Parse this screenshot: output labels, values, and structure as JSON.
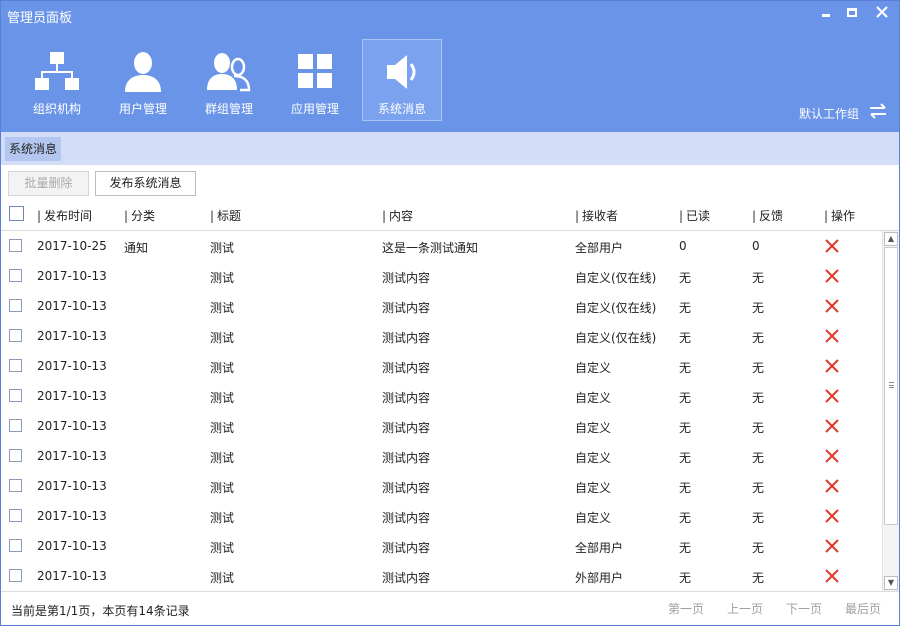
{
  "app": {
    "title": "管理员面板"
  },
  "nav": {
    "items": [
      {
        "label": "组织机构",
        "icon": "org-chart-icon"
      },
      {
        "label": "用户管理",
        "icon": "user-icon"
      },
      {
        "label": "群组管理",
        "icon": "group-icon"
      },
      {
        "label": "应用管理",
        "icon": "apps-grid-icon"
      },
      {
        "label": "系统消息",
        "icon": "speaker-icon",
        "active": true
      }
    ]
  },
  "workgroup": {
    "label": "默认工作组"
  },
  "tabs": [
    {
      "label": "系统消息"
    }
  ],
  "toolbar": {
    "batch_delete": "批量删除",
    "publish": "发布系统消息"
  },
  "table": {
    "columns": [
      "发布时间",
      "分类",
      "标题",
      "内容",
      "接收者",
      "已读",
      "反馈",
      "操作"
    ],
    "rows": [
      {
        "time": "2017-10-25",
        "category": "通知",
        "title": "测试",
        "content": "这是一条测试通知",
        "receiver": "全部用户",
        "read": "0",
        "feedback": "0"
      },
      {
        "time": "2017-10-13",
        "category": "",
        "title": "测试",
        "content": "测试内容",
        "receiver": "自定义(仅在线)",
        "read": "无",
        "feedback": "无"
      },
      {
        "time": "2017-10-13",
        "category": "",
        "title": "测试",
        "content": "测试内容",
        "receiver": "自定义(仅在线)",
        "read": "无",
        "feedback": "无"
      },
      {
        "time": "2017-10-13",
        "category": "",
        "title": "测试",
        "content": "测试内容",
        "receiver": "自定义(仅在线)",
        "read": "无",
        "feedback": "无"
      },
      {
        "time": "2017-10-13",
        "category": "",
        "title": "测试",
        "content": "测试内容",
        "receiver": "自定义",
        "read": "无",
        "feedback": "无"
      },
      {
        "time": "2017-10-13",
        "category": "",
        "title": "测试",
        "content": "测试内容",
        "receiver": "自定义",
        "read": "无",
        "feedback": "无"
      },
      {
        "time": "2017-10-13",
        "category": "",
        "title": "测试",
        "content": "测试内容",
        "receiver": "自定义",
        "read": "无",
        "feedback": "无"
      },
      {
        "time": "2017-10-13",
        "category": "",
        "title": "测试",
        "content": "测试内容",
        "receiver": "自定义",
        "read": "无",
        "feedback": "无"
      },
      {
        "time": "2017-10-13",
        "category": "",
        "title": "测试",
        "content": "测试内容",
        "receiver": "自定义",
        "read": "无",
        "feedback": "无"
      },
      {
        "time": "2017-10-13",
        "category": "",
        "title": "测试",
        "content": "测试内容",
        "receiver": "自定义",
        "read": "无",
        "feedback": "无"
      },
      {
        "time": "2017-10-13",
        "category": "",
        "title": "测试",
        "content": "测试内容",
        "receiver": "全部用户",
        "read": "无",
        "feedback": "无"
      },
      {
        "time": "2017-10-13",
        "category": "",
        "title": "测试",
        "content": "测试内容",
        "receiver": "外部用户",
        "read": "无",
        "feedback": "无"
      }
    ]
  },
  "footer": {
    "status": "当前是第1/1页，本页有14条记录",
    "first": "第一页",
    "prev": "上一页",
    "next": "下一页",
    "last": "最后页"
  },
  "colors": {
    "header": "#6a94e8",
    "tabbar": "#d3ddf7",
    "delete": "#e03a2c"
  }
}
